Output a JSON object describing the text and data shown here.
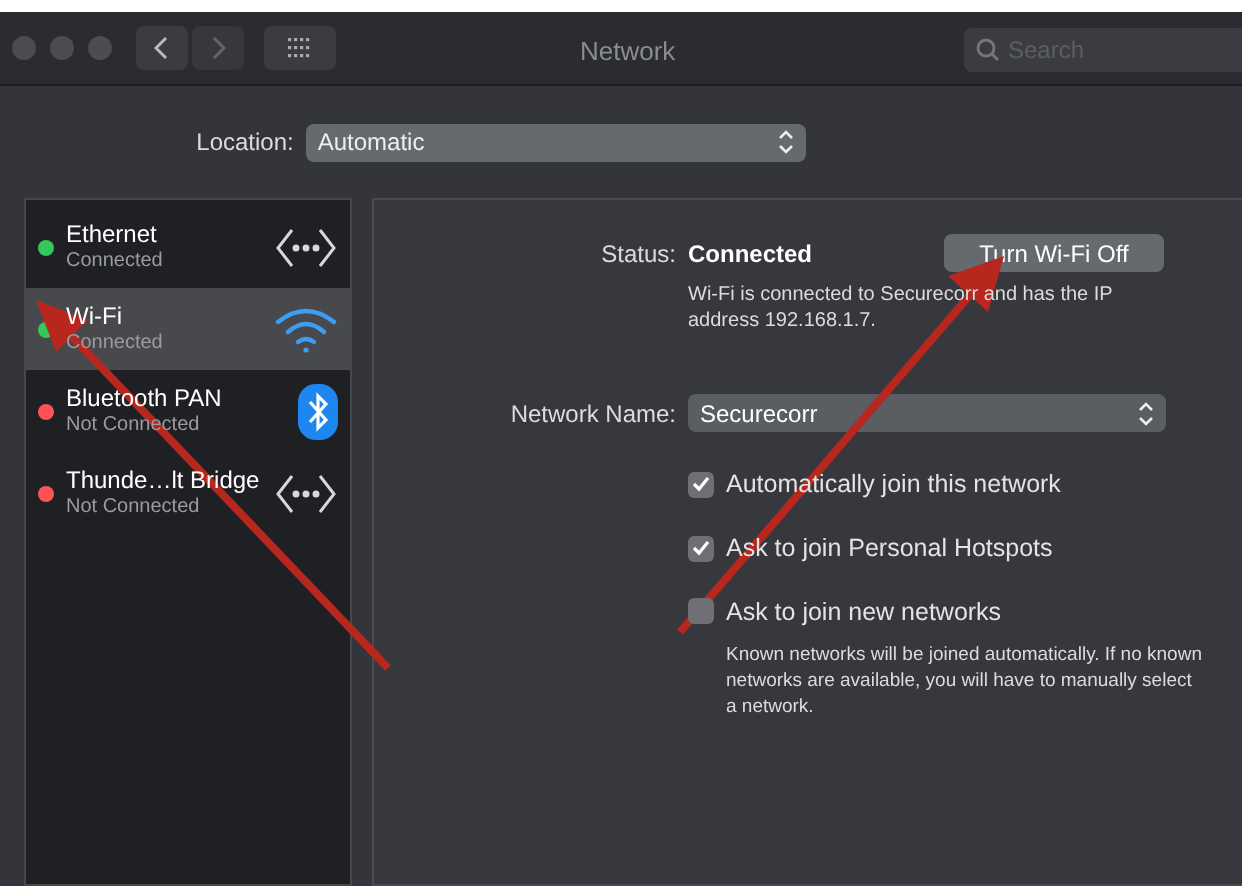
{
  "window": {
    "title": "Network"
  },
  "search": {
    "placeholder": "Search"
  },
  "location": {
    "label": "Location:",
    "value": "Automatic"
  },
  "sidebar": {
    "items": [
      {
        "name": "Ethernet",
        "status": "Connected",
        "color": "#34c759",
        "kind": "ethernet",
        "selected": false
      },
      {
        "name": "Wi-Fi",
        "status": "Connected",
        "color": "#34c759",
        "kind": "wifi",
        "selected": true
      },
      {
        "name": "Bluetooth PAN",
        "status": "Not Connected",
        "color": "#ff5257",
        "kind": "bluetooth",
        "selected": false
      },
      {
        "name": "Thunde…lt Bridge",
        "status": "Not Connected",
        "color": "#ff5257",
        "kind": "ethernet",
        "selected": false
      }
    ]
  },
  "detail": {
    "status_label": "Status:",
    "status_value": "Connected",
    "toggle_button": "Turn Wi-Fi Off",
    "status_description": "Wi-Fi is connected to Securecorr and has the IP address 192.168.1.7.",
    "network_name_label": "Network Name:",
    "network_name": "Securecorr",
    "options": [
      {
        "label": "Automatically join this network",
        "checked": true
      },
      {
        "label": "Ask to join Personal Hotspots",
        "checked": true
      },
      {
        "label": "Ask to join new networks",
        "checked": false
      }
    ],
    "note": "Known networks will be joined automatically. If no known networks are available, you will have to manually select a network."
  }
}
